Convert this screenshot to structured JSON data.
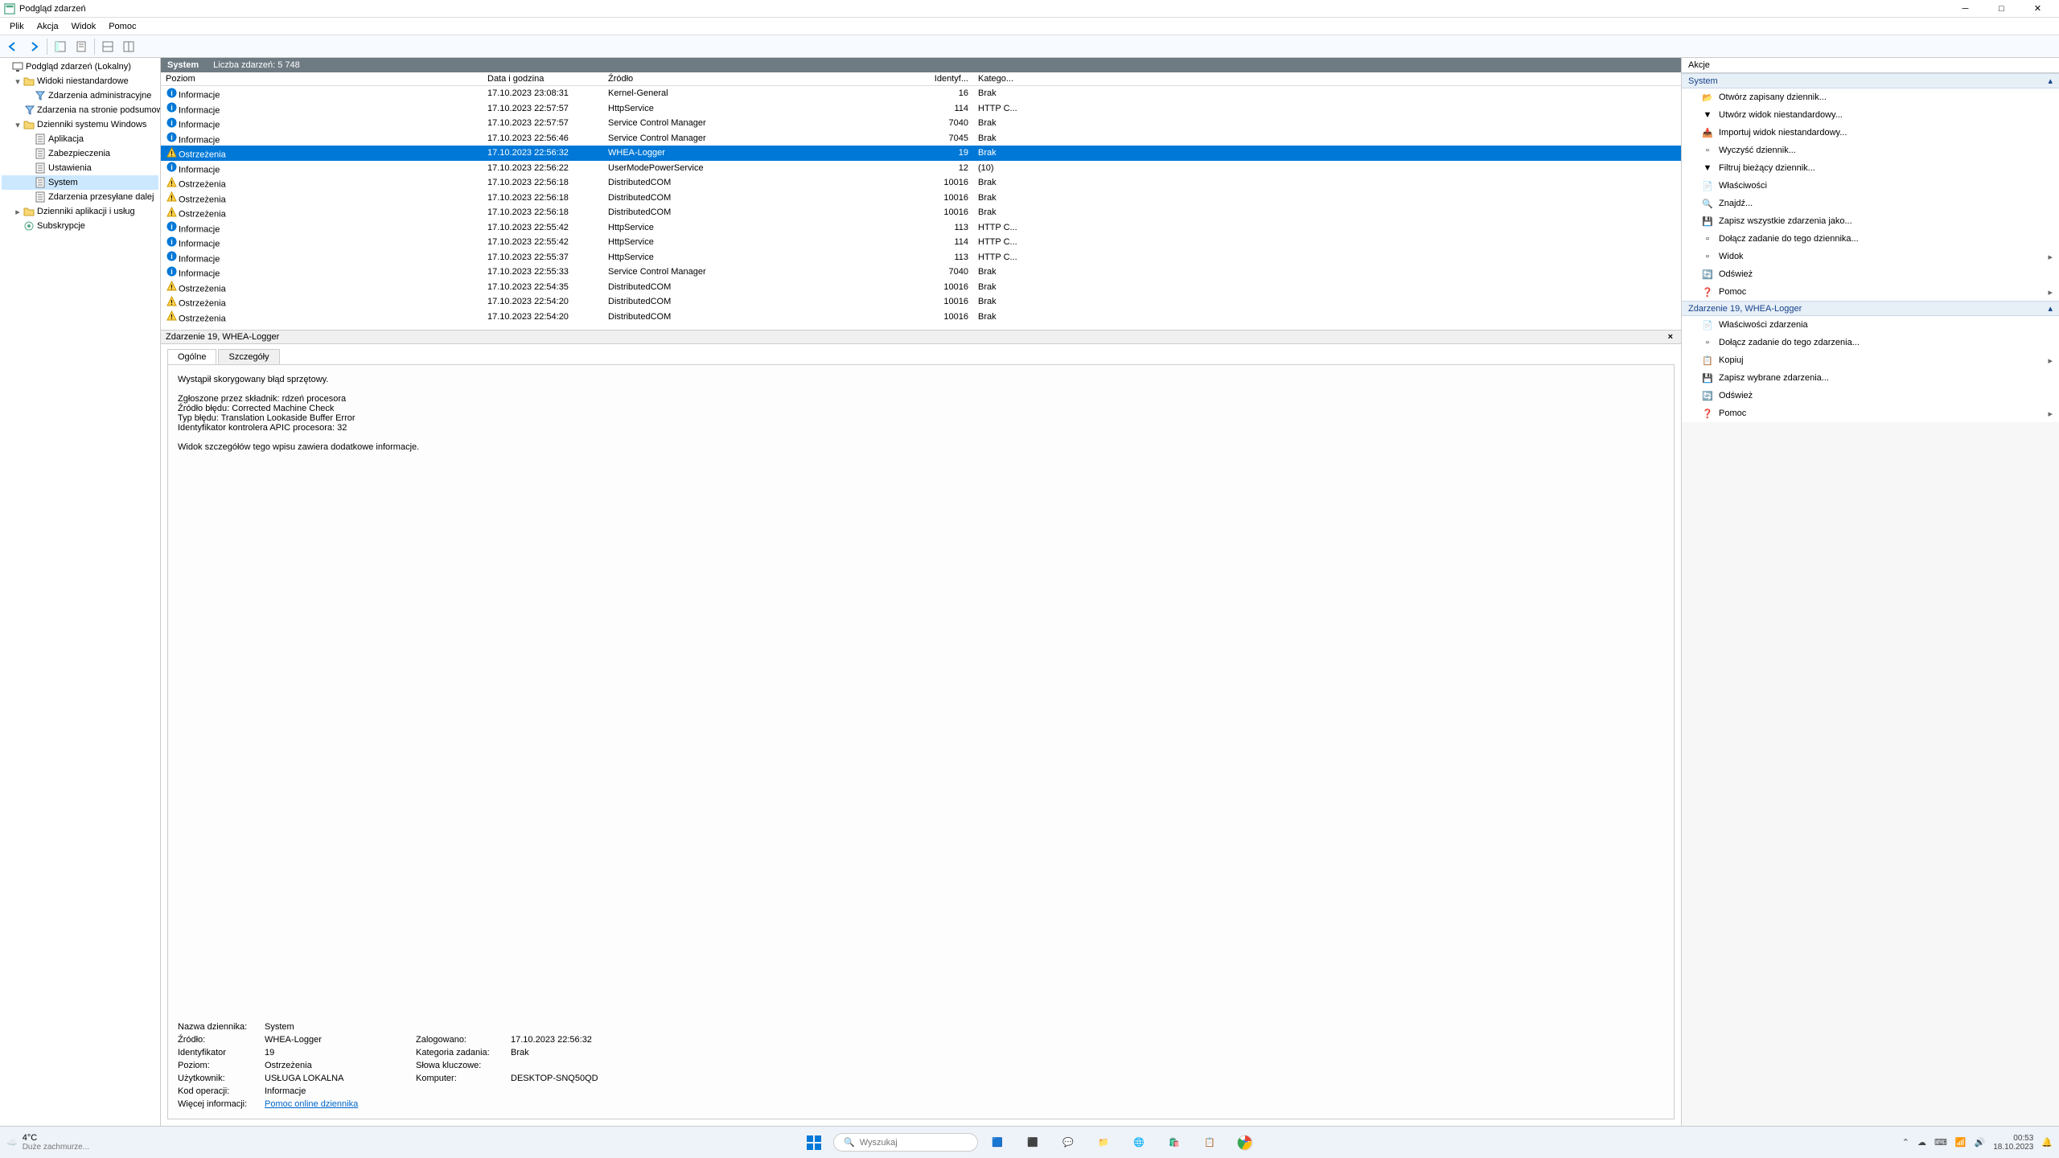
{
  "window": {
    "title": "Podgląd zdarzeń"
  },
  "menu": [
    "Plik",
    "Akcja",
    "Widok",
    "Pomoc"
  ],
  "tree": [
    {
      "label": "Podgląd zdarzeń (Lokalny)",
      "indent": 0,
      "icon": "computer",
      "toggle": ""
    },
    {
      "label": "Widoki niestandardowe",
      "indent": 1,
      "icon": "folder",
      "toggle": "▾"
    },
    {
      "label": "Zdarzenia administracyjne",
      "indent": 2,
      "icon": "filter",
      "toggle": ""
    },
    {
      "label": "Zdarzenia na stronie podsumowania",
      "indent": 2,
      "icon": "filter",
      "toggle": ""
    },
    {
      "label": "Dzienniki systemu Windows",
      "indent": 1,
      "icon": "folder",
      "toggle": "▾"
    },
    {
      "label": "Aplikacja",
      "indent": 2,
      "icon": "log",
      "toggle": ""
    },
    {
      "label": "Zabezpieczenia",
      "indent": 2,
      "icon": "log",
      "toggle": ""
    },
    {
      "label": "Ustawienia",
      "indent": 2,
      "icon": "log",
      "toggle": ""
    },
    {
      "label": "System",
      "indent": 2,
      "icon": "log",
      "toggle": "",
      "selected": true
    },
    {
      "label": "Zdarzenia przesyłane dalej",
      "indent": 2,
      "icon": "log",
      "toggle": ""
    },
    {
      "label": "Dzienniki aplikacji i usług",
      "indent": 1,
      "icon": "folder",
      "toggle": "▸"
    },
    {
      "label": "Subskrypcje",
      "indent": 1,
      "icon": "sub",
      "toggle": ""
    }
  ],
  "center_header": {
    "title": "System",
    "count_label": "Liczba zdarzeń: 5 748"
  },
  "columns": [
    "Poziom",
    "Data i godzina",
    "Źródło",
    "Identyf...",
    "Katego..."
  ],
  "events": [
    {
      "lvl": "info",
      "level": "Informacje",
      "date": "17.10.2023 23:08:31",
      "src": "Kernel-General",
      "id": "16",
      "cat": "Brak"
    },
    {
      "lvl": "info",
      "level": "Informacje",
      "date": "17.10.2023 22:57:57",
      "src": "HttpService",
      "id": "114",
      "cat": "HTTP C..."
    },
    {
      "lvl": "info",
      "level": "Informacje",
      "date": "17.10.2023 22:57:57",
      "src": "Service Control Manager",
      "id": "7040",
      "cat": "Brak"
    },
    {
      "lvl": "info",
      "level": "Informacje",
      "date": "17.10.2023 22:56:46",
      "src": "Service Control Manager",
      "id": "7045",
      "cat": "Brak"
    },
    {
      "lvl": "warn",
      "level": "Ostrzeżenia",
      "date": "17.10.2023 22:56:32",
      "src": "WHEA-Logger",
      "id": "19",
      "cat": "Brak",
      "selected": true
    },
    {
      "lvl": "info",
      "level": "Informacje",
      "date": "17.10.2023 22:56:22",
      "src": "UserModePowerService",
      "id": "12",
      "cat": "(10)"
    },
    {
      "lvl": "warn",
      "level": "Ostrzeżenia",
      "date": "17.10.2023 22:56:18",
      "src": "DistributedCOM",
      "id": "10016",
      "cat": "Brak"
    },
    {
      "lvl": "warn",
      "level": "Ostrzeżenia",
      "date": "17.10.2023 22:56:18",
      "src": "DistributedCOM",
      "id": "10016",
      "cat": "Brak"
    },
    {
      "lvl": "warn",
      "level": "Ostrzeżenia",
      "date": "17.10.2023 22:56:18",
      "src": "DistributedCOM",
      "id": "10016",
      "cat": "Brak"
    },
    {
      "lvl": "info",
      "level": "Informacje",
      "date": "17.10.2023 22:55:42",
      "src": "HttpService",
      "id": "113",
      "cat": "HTTP C..."
    },
    {
      "lvl": "info",
      "level": "Informacje",
      "date": "17.10.2023 22:55:42",
      "src": "HttpService",
      "id": "114",
      "cat": "HTTP C..."
    },
    {
      "lvl": "info",
      "level": "Informacje",
      "date": "17.10.2023 22:55:37",
      "src": "HttpService",
      "id": "113",
      "cat": "HTTP C..."
    },
    {
      "lvl": "info",
      "level": "Informacje",
      "date": "17.10.2023 22:55:33",
      "src": "Service Control Manager",
      "id": "7040",
      "cat": "Brak"
    },
    {
      "lvl": "warn",
      "level": "Ostrzeżenia",
      "date": "17.10.2023 22:54:35",
      "src": "DistributedCOM",
      "id": "10016",
      "cat": "Brak"
    },
    {
      "lvl": "warn",
      "level": "Ostrzeżenia",
      "date": "17.10.2023 22:54:20",
      "src": "DistributedCOM",
      "id": "10016",
      "cat": "Brak"
    },
    {
      "lvl": "warn",
      "level": "Ostrzeżenia",
      "date": "17.10.2023 22:54:20",
      "src": "DistributedCOM",
      "id": "10016",
      "cat": "Brak"
    }
  ],
  "detail": {
    "title": "Zdarzenie 19, WHEA-Logger",
    "tabs": {
      "general": "Ogólne",
      "details": "Szczegóły"
    },
    "message": "Wystąpił skorygowany błąd sprzętowy.\n\nZgłoszone przez składnik: rdzeń procesora\nŹródło błędu: Corrected Machine Check\nTyp błędu: Translation Lookaside Buffer Error\nIdentyfikator kontrolera APIC procesora: 32\n\nWidok szczegółów tego wpisu zawiera dodatkowe informacje.",
    "props": {
      "log_name_label": "Nazwa dziennika:",
      "log_name": "System",
      "source_label": "Źródło:",
      "source": "WHEA-Logger",
      "logged_label": "Zalogowano:",
      "logged": "17.10.2023 22:56:32",
      "id_label": "Identyfikator",
      "id": "19",
      "task_cat_label": "Kategoria zadania:",
      "task_cat": "Brak",
      "level_label": "Poziom:",
      "level": "Ostrzeżenia",
      "keywords_label": "Słowa kluczowe:",
      "keywords": "",
      "user_label": "Użytkownik:",
      "user": "USŁUGA LOKALNA",
      "computer_label": "Komputer:",
      "computer": "DESKTOP-SNQ50QD",
      "opcode_label": "Kod operacji:",
      "opcode": "Informacje",
      "more_label": "Więcej informacji:",
      "more_link": "Pomoc online dziennika"
    }
  },
  "actions": {
    "header": "Akcje",
    "group1_title": "System",
    "group1": [
      {
        "label": "Otwórz zapisany dziennik...",
        "icon": "open"
      },
      {
        "label": "Utwórz widok niestandardowy...",
        "icon": "filter"
      },
      {
        "label": "Importuj widok niestandardowy...",
        "icon": "import"
      },
      {
        "label": "Wyczyść dziennik...",
        "icon": "clear"
      },
      {
        "label": "Filtruj bieżący dziennik...",
        "icon": "filter"
      },
      {
        "label": "Właściwości",
        "icon": "props"
      },
      {
        "label": "Znajdź...",
        "icon": "find"
      },
      {
        "label": "Zapisz wszystkie zdarzenia jako...",
        "icon": "save"
      },
      {
        "label": "Dołącz zadanie do tego dziennika...",
        "icon": "task"
      },
      {
        "label": "Widok",
        "icon": "view",
        "arrow": true
      },
      {
        "label": "Odśwież",
        "icon": "refresh"
      },
      {
        "label": "Pomoc",
        "icon": "help",
        "arrow": true
      }
    ],
    "group2_title": "Zdarzenie 19, WHEA-Logger",
    "group2": [
      {
        "label": "Właściwości zdarzenia",
        "icon": "props"
      },
      {
        "label": "Dołącz zadanie do tego zdarzenia...",
        "icon": "task"
      },
      {
        "label": "Kopiuj",
        "icon": "copy",
        "arrow": true
      },
      {
        "label": "Zapisz wybrane zdarzenia...",
        "icon": "save"
      },
      {
        "label": "Odśwież",
        "icon": "refresh"
      },
      {
        "label": "Pomoc",
        "icon": "help",
        "arrow": true
      }
    ]
  },
  "taskbar": {
    "weather_temp": "4°C",
    "weather_desc": "Duże zachmurze...",
    "search_placeholder": "Wyszukaj",
    "time": "00:53",
    "date": "18.10.2023"
  }
}
